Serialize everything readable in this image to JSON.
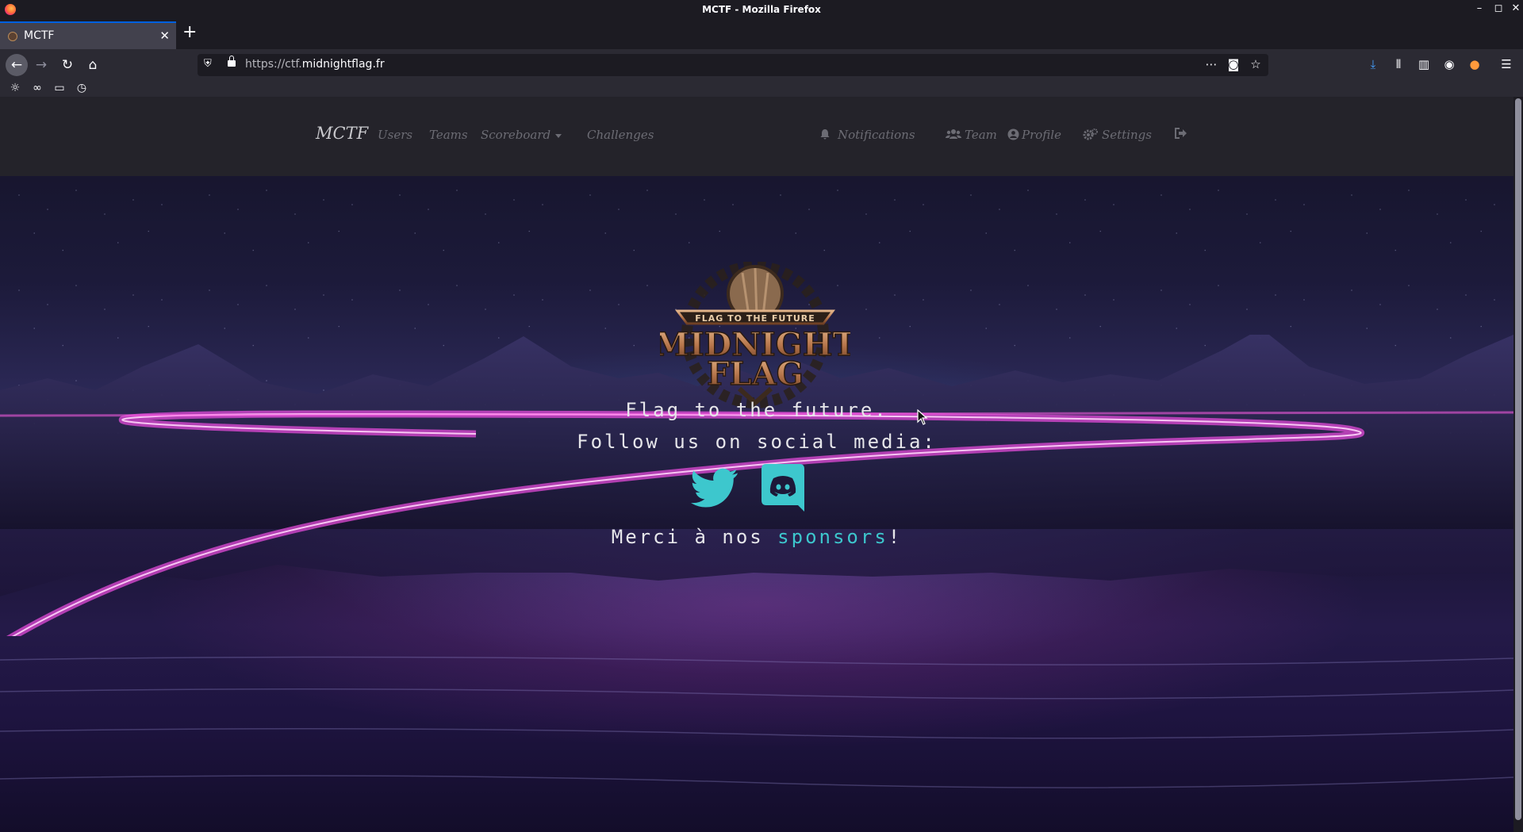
{
  "window": {
    "title": "MCTF - Mozilla Firefox",
    "controls": [
      "minimize-icon",
      "maximize-icon",
      "close-icon"
    ]
  },
  "tabs": [
    {
      "title": "MCTF",
      "active": true
    }
  ],
  "navbar": {
    "url_prefix": "https://ctf.",
    "url_host": "midnightflag.fr",
    "icons": [
      "back-arrow-icon",
      "forward-arrow-icon",
      "reload-icon",
      "home-icon",
      "shield-icon",
      "lock-icon",
      "more-icon",
      "pocket-icon",
      "star-icon",
      "download-icon",
      "library-icon",
      "sidebar-icon",
      "account-icon",
      "extension-icon",
      "menu-icon"
    ]
  },
  "bookmarks": {
    "icons": [
      "sun-icon",
      "glasses-icon",
      "folder-icon",
      "clock-icon"
    ]
  },
  "site": {
    "brand": "MCTF",
    "left_links": [
      "Users",
      "Teams",
      "Scoreboard",
      "Challenges"
    ],
    "right_links": [
      "Notifications",
      "Team",
      "Profile",
      "Settings"
    ],
    "logo": {
      "ribbon": "FLAG TO THE FUTURE",
      "line1": "MIDNIGHT",
      "line2": "FLAG"
    },
    "hero": {
      "tagline": "Flag to the future.",
      "follow": "Follow us on social media:",
      "thanks_prefix": "Merci à nos ",
      "thanks_link": "sponsors",
      "thanks_suffix": "!"
    },
    "social": [
      "twitter-icon",
      "discord-icon"
    ]
  },
  "colors": {
    "accent": "#3dc7cd",
    "firefox_blue": "#0060df",
    "nav_bg": "#24232a",
    "beam": "#e34bd8"
  }
}
